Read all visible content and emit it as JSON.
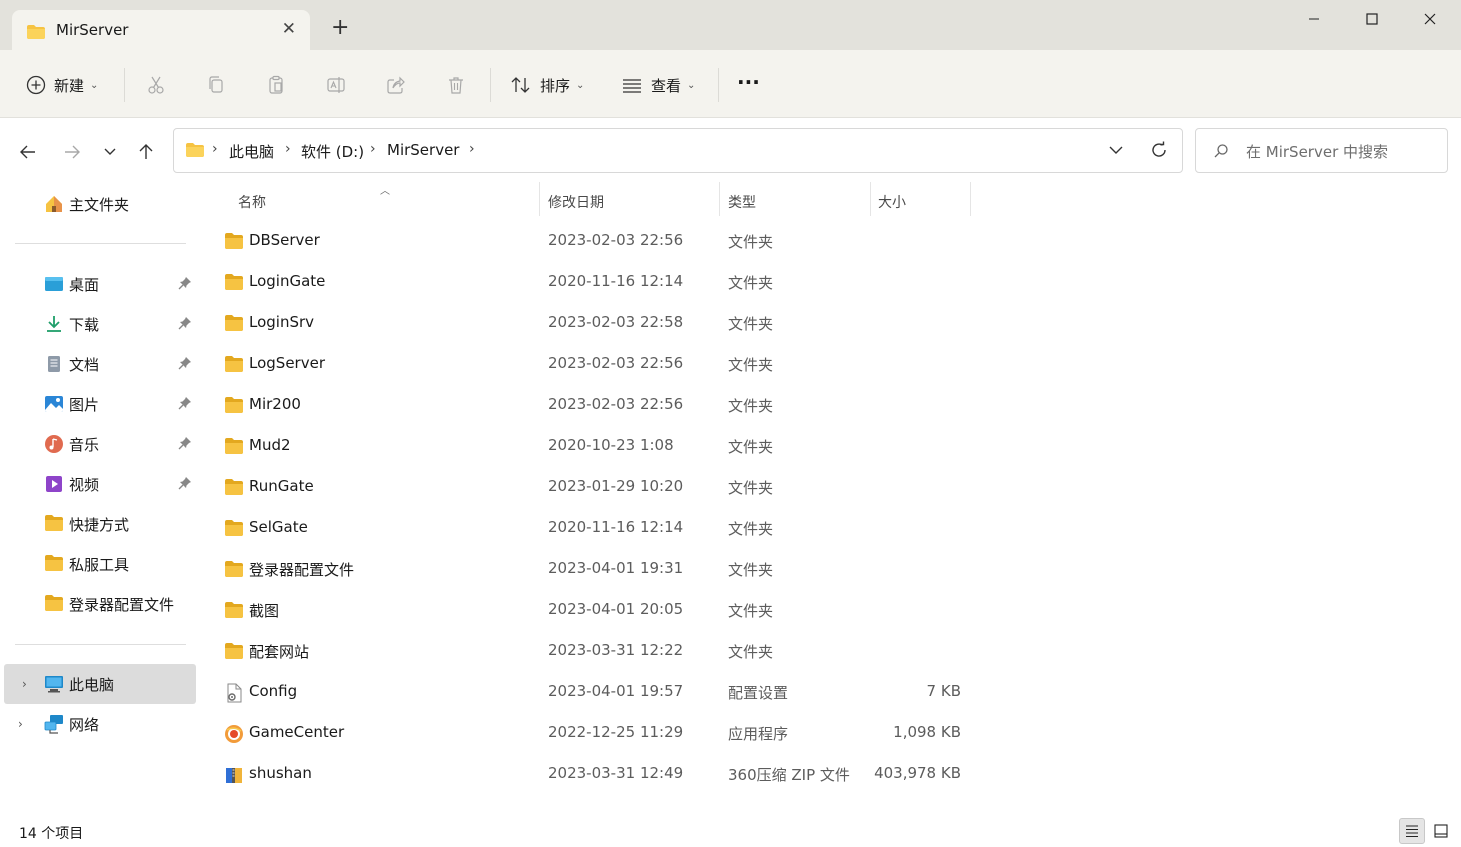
{
  "window": {
    "tab_title": "MirServer",
    "new_tab_symbol": "+",
    "close_tab_symbol": "✕"
  },
  "toolbar": {
    "new_label": "新建",
    "sort_label": "排序",
    "view_label": "查看",
    "more_label": "···"
  },
  "address": {
    "crumbs": [
      "此电脑",
      "软件 (D:)",
      "MirServer"
    ],
    "search_placeholder": "在 MirServer 中搜索"
  },
  "sidebar": {
    "home": "主文件夹",
    "pinned": [
      {
        "label": "桌面",
        "icon": "desktop-icon"
      },
      {
        "label": "下载",
        "icon": "download-icon"
      },
      {
        "label": "文档",
        "icon": "document-icon"
      },
      {
        "label": "图片",
        "icon": "pictures-icon"
      },
      {
        "label": "音乐",
        "icon": "music-icon"
      },
      {
        "label": "视频",
        "icon": "video-icon"
      }
    ],
    "folders": [
      "快捷方式",
      "私服工具",
      "登录器配置文件"
    ],
    "this_pc": "此电脑",
    "network": "网络"
  },
  "columns": {
    "name": "名称",
    "date": "修改日期",
    "type": "类型",
    "size": "大小"
  },
  "files": [
    {
      "name": "DBServer",
      "date": "2023-02-03 22:56",
      "type": "文件夹",
      "size": "",
      "kind": "folder"
    },
    {
      "name": "LoginGate",
      "date": "2020-11-16 12:14",
      "type": "文件夹",
      "size": "",
      "kind": "folder"
    },
    {
      "name": "LoginSrv",
      "date": "2023-02-03 22:58",
      "type": "文件夹",
      "size": "",
      "kind": "folder"
    },
    {
      "name": "LogServer",
      "date": "2023-02-03 22:56",
      "type": "文件夹",
      "size": "",
      "kind": "folder"
    },
    {
      "name": "Mir200",
      "date": "2023-02-03 22:56",
      "type": "文件夹",
      "size": "",
      "kind": "folder"
    },
    {
      "name": "Mud2",
      "date": "2020-10-23 1:08",
      "type": "文件夹",
      "size": "",
      "kind": "folder"
    },
    {
      "name": "RunGate",
      "date": "2023-01-29 10:20",
      "type": "文件夹",
      "size": "",
      "kind": "folder"
    },
    {
      "name": "SelGate",
      "date": "2020-11-16 12:14",
      "type": "文件夹",
      "size": "",
      "kind": "folder"
    },
    {
      "name": "登录器配置文件",
      "date": "2023-04-01 19:31",
      "type": "文件夹",
      "size": "",
      "kind": "folder"
    },
    {
      "name": "截图",
      "date": "2023-04-01 20:05",
      "type": "文件夹",
      "size": "",
      "kind": "folder"
    },
    {
      "name": "配套网站",
      "date": "2023-03-31 12:22",
      "type": "文件夹",
      "size": "",
      "kind": "folder"
    },
    {
      "name": "Config",
      "date": "2023-04-01 19:57",
      "type": "配置设置",
      "size": "7 KB",
      "kind": "config"
    },
    {
      "name": "GameCenter",
      "date": "2022-12-25 11:29",
      "type": "应用程序",
      "size": "1,098 KB",
      "kind": "app"
    },
    {
      "name": "shushan",
      "date": "2023-03-31 12:49",
      "type": "360压缩 ZIP 文件",
      "size": "403,978 KB",
      "kind": "zip"
    }
  ],
  "status": {
    "item_count": "14 个项目"
  },
  "colors": {
    "folder": "#f6c342",
    "folder_dark": "#e3a81f",
    "titlebar": "#e3e2dc",
    "commandbar": "#f4f3ee",
    "selected": "#dcdcdc"
  }
}
